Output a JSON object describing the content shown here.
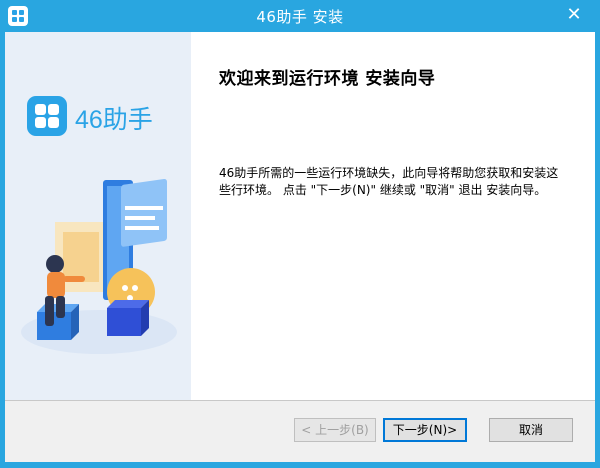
{
  "window": {
    "title": "46助手 安装",
    "close_glyph": "✕"
  },
  "sidebar": {
    "logo_text": "46助手"
  },
  "main": {
    "heading": "欢迎来到运行环境 安装向导",
    "description": "46助手所需的一些运行环境缺失，此向导将帮助您获取和安装这些行环境。 点击 \"下一步(N)\" 继续或 \"取消\" 退出 安装向导。"
  },
  "buttons": {
    "prev_label": "< 上一步(B)",
    "next_label": "下一步(N)>",
    "cancel_label": "取消"
  },
  "colors": {
    "titlebar": "#29a6e0",
    "brand": "#2aa3e6",
    "sidebar_bg": "#e8eff8",
    "focus_border": "#0078d7"
  },
  "icons": {
    "app": "app-logo-icon",
    "close": "close-icon",
    "logo": "brand-logo-icon"
  }
}
